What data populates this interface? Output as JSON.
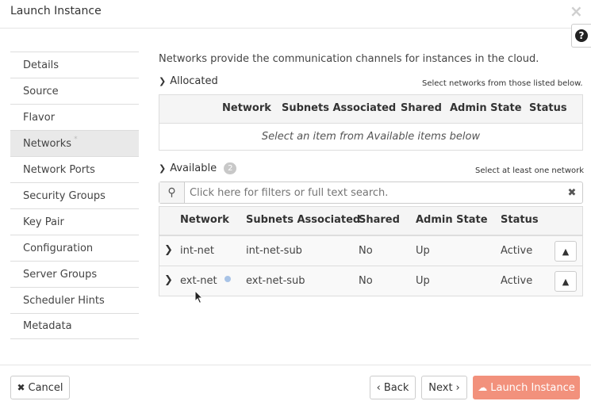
{
  "window": {
    "title": "Launch Instance",
    "close_icon": "×",
    "help_icon": "?"
  },
  "sidebar": {
    "items": [
      {
        "label": "Details"
      },
      {
        "label": "Source"
      },
      {
        "label": "Flavor"
      },
      {
        "label": "Networks",
        "required_mark": "*"
      },
      {
        "label": "Network Ports"
      },
      {
        "label": "Security Groups"
      },
      {
        "label": "Key Pair"
      },
      {
        "label": "Configuration"
      },
      {
        "label": "Server Groups"
      },
      {
        "label": "Scheduler Hints"
      },
      {
        "label": "Metadata"
      }
    ],
    "active_index": 3
  },
  "main": {
    "intro": "Networks provide the communication channels for instances in the cloud.",
    "allocated": {
      "title": "Allocated",
      "hint": "Select networks from those listed below.",
      "columns": [
        "Network",
        "Subnets Associated",
        "Shared",
        "Admin State",
        "Status"
      ],
      "empty_message": "Select an item from Available items below"
    },
    "available": {
      "title": "Available",
      "count": "2",
      "hint": "Select at least one network",
      "search_placeholder": "Click here for filters or full text search.",
      "clear_icon": "✖",
      "columns": [
        "Network",
        "Subnets Associated",
        "Shared",
        "Admin State",
        "Status"
      ],
      "rows": [
        {
          "network": "int-net",
          "subnets": "int-net-sub",
          "shared": "No",
          "admin_state": "Up",
          "status": "Active"
        },
        {
          "network": "ext-net",
          "subnets": "ext-net-sub",
          "shared": "No",
          "admin_state": "Up",
          "status": "Active"
        }
      ]
    }
  },
  "footer": {
    "cancel_label": "Cancel",
    "back_label": "Back",
    "next_label": "Next",
    "launch_label": "Launch Instance"
  },
  "colors": {
    "primary": "#f2917c",
    "active_sidebar": "#e9e9e9",
    "info_dot": "#a8c3e6"
  }
}
